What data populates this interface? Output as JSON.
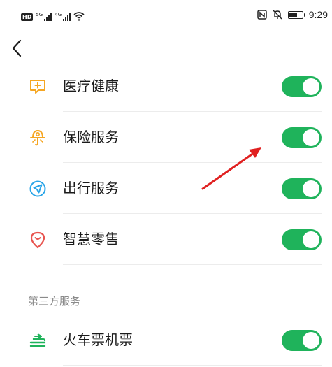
{
  "status_bar": {
    "badge": "HD",
    "signal1": "5G",
    "signal2": "4G",
    "time": "9:29",
    "battery_level": 0.7
  },
  "rows": [
    {
      "label": "医疗健康",
      "icon": "medical-icon",
      "enabled": true
    },
    {
      "label": "保险服务",
      "icon": "insurance-icon",
      "enabled": true
    },
    {
      "label": "出行服务",
      "icon": "travel-icon",
      "enabled": true
    },
    {
      "label": "智慧零售",
      "icon": "retail-icon",
      "enabled": true
    }
  ],
  "section_header": "第三方服务",
  "third_party_rows": [
    {
      "label": "火车票机票",
      "icon": "train-icon",
      "enabled": true
    }
  ],
  "colors": {
    "toggle_on": "#1fb35b",
    "annotation_arrow": "#e02020",
    "icon_orange": "#f5a623",
    "icon_blue": "#2aa5e8",
    "icon_red": "#e8544f",
    "icon_green": "#1fb35b"
  }
}
